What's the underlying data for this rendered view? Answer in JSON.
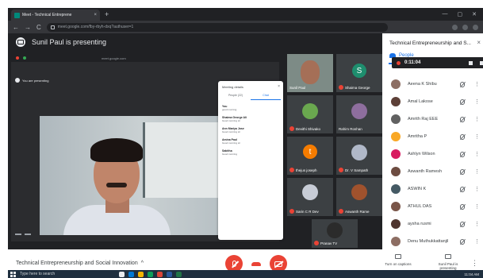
{
  "browser": {
    "tab_title": "Meet - Technical Entreprene",
    "tab_close": "×",
    "new_tab": "+",
    "url": "meet.google.com/fby-rbyh-dxq?authuser=1",
    "window_controls": [
      "—",
      "▢",
      "✕"
    ],
    "nav": [
      "←",
      "→",
      "C"
    ]
  },
  "meet": {
    "presenting_label": "Sunil Paul is presenting",
    "shared_screen": {
      "tab_url": "meet.google.com",
      "you_presenting": "You are presenting"
    },
    "details_panel": {
      "title": "Meeting details",
      "close": "×",
      "tabs": [
        "People (22)",
        "Chat"
      ],
      "messages": [
        {
          "name": "You",
          "text": "good morning"
        },
        {
          "name": "Shaima George Ali",
          "text": "Good morning sir"
        },
        {
          "name": "Ann Mariya Jose",
          "text": "Good morning sir"
        },
        {
          "name": "Amina Paul",
          "text": "Good morning sir"
        },
        {
          "name": "Sabitha",
          "text": "Good morning"
        }
      ]
    }
  },
  "tiles": [
    {
      "name": "Sunil Paul",
      "muted": false
    },
    {
      "name": "Shaima George",
      "initial": "S",
      "muted": true
    },
    {
      "name": "Devithi Shivako",
      "muted": true
    },
    {
      "name": "Rahim Roshan",
      "muted": false
    },
    {
      "name": "thejus joseph",
      "initial": "t",
      "muted": true
    },
    {
      "name": "Dr. V Sampath",
      "muted": true
    },
    {
      "name": "Sarin C R Dev",
      "muted": true
    },
    {
      "name": "Aswanth Rame",
      "muted": true
    },
    {
      "name": "Pranav TV",
      "muted": true
    }
  ],
  "side_panel": {
    "title": "Technical Entrepreneurship and S...",
    "close": "×",
    "people_tab": "People",
    "recording_time": "0:11:04",
    "participants": [
      {
        "name": "Aeena K Shibu",
        "color": "#8d6e63"
      },
      {
        "name": "Amal Lakose",
        "color": "#5d4037"
      },
      {
        "name": "Amrith Raj EEE",
        "color": "#616161"
      },
      {
        "name": "Amritha P",
        "color": "#f9a825"
      },
      {
        "name": "Ashlyn Wilson",
        "color": "#d81b60"
      },
      {
        "name": "Aswanth Ramesh",
        "color": "#6d4c41"
      },
      {
        "name": "ASWIN K",
        "color": "#455a64"
      },
      {
        "name": "ATHUL DAS",
        "color": "#795548"
      },
      {
        "name": "aysha rusmi",
        "color": "#4e342e"
      },
      {
        "name": "Denu Muthukkattanjil",
        "color": "#8d6e63"
      }
    ]
  },
  "bottom_bar": {
    "meeting_title": "Technical Entrepreneurship and Social Innovation",
    "chevron": "^",
    "captions_label": "Turn on captions",
    "presenting_btn": "Sunil Paul is presenting",
    "more": "⋮"
  },
  "taskbar": {
    "search_placeholder": "Type here to search",
    "clock": "11:04 AM"
  }
}
